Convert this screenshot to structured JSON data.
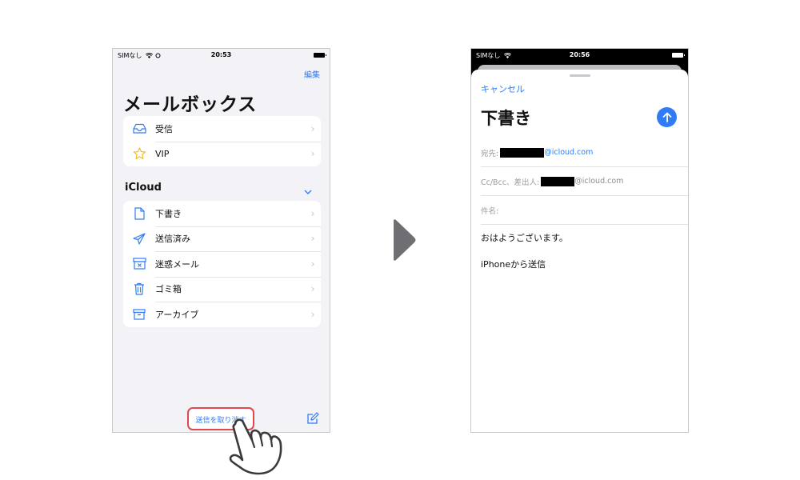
{
  "left_screen": {
    "status": {
      "carrier": "SIMなし",
      "time": "20:53"
    },
    "edit_label": "編集",
    "title": "メールボックス",
    "mailboxes": [
      {
        "label": "受信",
        "icon": "inbox-tray-icon"
      },
      {
        "label": "VIP",
        "icon": "star-icon"
      }
    ],
    "account_section": {
      "title": "iCloud",
      "icon": "chevron-down-icon"
    },
    "folders": [
      {
        "label": "下書き",
        "icon": "document-icon"
      },
      {
        "label": "送信済み",
        "icon": "paper-plane-icon"
      },
      {
        "label": "迷惑メール",
        "icon": "junk-tray-icon"
      },
      {
        "label": "ゴミ箱",
        "icon": "trash-icon"
      },
      {
        "label": "アーカイブ",
        "icon": "archive-box-icon"
      }
    ],
    "undo_send_label": "送信を取り消す",
    "compose_icon": "compose-icon"
  },
  "arrow_icon": "triangle-right-icon",
  "right_screen": {
    "status": {
      "carrier": "SIMなし",
      "time": "20:56"
    },
    "cancel_label": "キャンセル",
    "title": "下書き",
    "send_icon": "arrow-up-icon",
    "to_label": "宛先:",
    "to_domain": "@icloud.com",
    "cc_label": "Cc/Bcc、差出人:",
    "cc_domain": "@icloud.com",
    "subject_label": "件名:",
    "body_line_1": "おはようございます。",
    "body_line_2": "iPhoneから送信"
  },
  "colors": {
    "accent": "#2f7cf6",
    "highlight": "#e0484e",
    "background": "#f2f2f7"
  }
}
